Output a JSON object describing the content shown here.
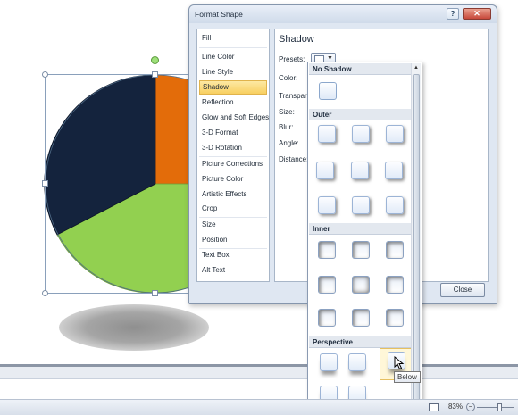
{
  "dialog": {
    "title": "Format Shape",
    "help_label": "?",
    "close_label": "✕",
    "close_button_label": "Close"
  },
  "categories": [
    {
      "label": "Fill"
    },
    {
      "label": "Line Color"
    },
    {
      "label": "Line Style"
    },
    {
      "label": "Shadow",
      "selected": true
    },
    {
      "label": "Reflection"
    },
    {
      "label": "Glow and Soft Edges"
    },
    {
      "label": "3-D Format"
    },
    {
      "label": "3-D Rotation"
    },
    {
      "label": "Picture Corrections"
    },
    {
      "label": "Picture Color"
    },
    {
      "label": "Artistic Effects"
    },
    {
      "label": "Crop"
    },
    {
      "label": "Size"
    },
    {
      "label": "Position"
    },
    {
      "label": "Text Box"
    },
    {
      "label": "Alt Text"
    }
  ],
  "pane": {
    "title": "Shadow",
    "labels": {
      "presets": "Presets:",
      "color": "Color:",
      "transparency": "Transpare",
      "size": "Size:",
      "blur": "Blur:",
      "angle": "Angle:",
      "distance": "Distance:"
    }
  },
  "gallery": {
    "headers": {
      "no_shadow": "No Shadow",
      "outer": "Outer",
      "inner": "Inner",
      "perspective": "Perspective"
    },
    "tooltip": "Below"
  },
  "status": {
    "zoom": "83%",
    "zoom_minus": "−"
  },
  "pie_colors": {
    "navy": "#14233d",
    "orange": "#e36c0a",
    "green": "#92d050"
  }
}
